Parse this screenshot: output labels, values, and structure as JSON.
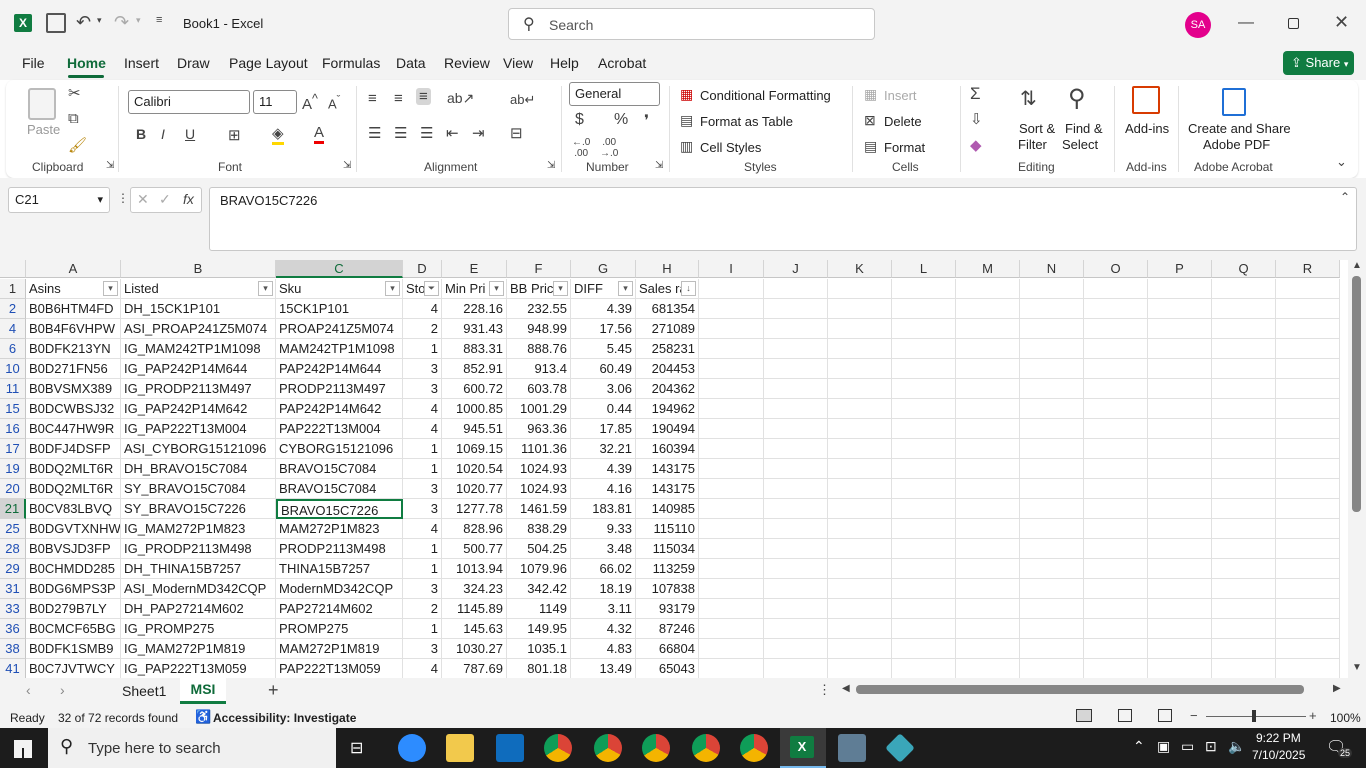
{
  "title_bar": {
    "doc_title": "Book1  -  Excel",
    "search_placeholder": "Search",
    "user_initials": "SA",
    "accent_color": "#0f6b3a"
  },
  "ribbon_tabs": [
    "File",
    "Home",
    "Insert",
    "Draw",
    "Page Layout",
    "Formulas",
    "Data",
    "Review",
    "View",
    "Help",
    "Acrobat"
  ],
  "share_label": "Share",
  "ribbon": {
    "paste": "Paste",
    "clipboard": "Clipboard",
    "font_name": "Calibri",
    "font_size": "11",
    "font_group": "Font",
    "alignment_group": "Alignment",
    "number_format": "General",
    "number_group": "Number",
    "cond_format": "Conditional Formatting",
    "format_table": "Format as Table",
    "cell_styles": "Cell Styles",
    "styles_group": "Styles",
    "insert": "Insert",
    "delete": "Delete",
    "format": "Format",
    "cells_group": "Cells",
    "sort_filter_1": "Sort &",
    "sort_filter_2": "Filter",
    "find_select_1": "Find &",
    "find_select_2": "Select",
    "editing_group": "Editing",
    "addins": "Add-ins",
    "addins_group": "Add-ins",
    "create_pdf_1": "Create and Share",
    "create_pdf_2": "Adobe PDF",
    "acrobat_group": "Adobe Acrobat"
  },
  "formula_bar": {
    "name_box": "C21",
    "formula": "BRAVO15C7226"
  },
  "columns": [
    "A",
    "B",
    "C",
    "D",
    "E",
    "F",
    "G",
    "H",
    "I",
    "J",
    "K",
    "L",
    "M",
    "N",
    "O",
    "P",
    "Q",
    "R"
  ],
  "headers": [
    "Asins",
    "Listed",
    "Sku",
    "Sto",
    "Min Pri",
    "BB Pric",
    "DIFF",
    "Sales ra"
  ],
  "rows": [
    {
      "n": "1",
      "cells": [
        "Asins",
        "Listed",
        "Sku",
        "Sto",
        "Min Pri",
        "BB Pric",
        "DIFF",
        "Sales ra"
      ]
    },
    {
      "n": "2",
      "cells": [
        "B0B6HTM4FD",
        "DH_15CK1P101",
        "15CK1P101",
        "4",
        "228.16",
        "232.55",
        "4.39",
        "681354"
      ]
    },
    {
      "n": "4",
      "cells": [
        "B0B4F6VHPW",
        "ASI_PROAP241Z5M074",
        "PROAP241Z5M074",
        "2",
        "931.43",
        "948.99",
        "17.56",
        "271089"
      ]
    },
    {
      "n": "6",
      "cells": [
        "B0DFK213YN",
        "IG_MAM242TP1M1098",
        "MAM242TP1M1098",
        "1",
        "883.31",
        "888.76",
        "5.45",
        "258231"
      ]
    },
    {
      "n": "10",
      "cells": [
        "B0D271FN56",
        "IG_PAP242P14M644",
        "PAP242P14M644",
        "3",
        "852.91",
        "913.4",
        "60.49",
        "204453"
      ]
    },
    {
      "n": "11",
      "cells": [
        "B0BVSMX389",
        "IG_PRODP2113M497",
        "PRODP2113M497",
        "3",
        "600.72",
        "603.78",
        "3.06",
        "204362"
      ]
    },
    {
      "n": "15",
      "cells": [
        "B0DCWBSJ32",
        "IG_PAP242P14M642",
        "PAP242P14M642",
        "4",
        "1000.85",
        "1001.29",
        "0.44",
        "194962"
      ]
    },
    {
      "n": "16",
      "cells": [
        "B0C447HW9R",
        "IG_PAP222T13M004",
        "PAP222T13M004",
        "4",
        "945.51",
        "963.36",
        "17.85",
        "190494"
      ]
    },
    {
      "n": "17",
      "cells": [
        "B0DFJ4DSFP",
        "ASI_CYBORG15121096",
        "CYBORG15121096",
        "1",
        "1069.15",
        "1101.36",
        "32.21",
        "160394"
      ]
    },
    {
      "n": "19",
      "cells": [
        "B0DQ2MLT6R",
        "DH_BRAVO15C7084",
        "BRAVO15C7084",
        "1",
        "1020.54",
        "1024.93",
        "4.39",
        "143175"
      ]
    },
    {
      "n": "20",
      "cells": [
        "B0DQ2MLT6R",
        "SY_BRAVO15C7084",
        "BRAVO15C7084",
        "3",
        "1020.77",
        "1024.93",
        "4.16",
        "143175"
      ]
    },
    {
      "n": "21",
      "cells": [
        "B0CV83LBVQ",
        "SY_BRAVO15C7226",
        "BRAVO15C7226",
        "3",
        "1277.78",
        "1461.59",
        "183.81",
        "140985"
      ]
    },
    {
      "n": "25",
      "cells": [
        "B0DGVTXNHW",
        "IG_MAM272P1M823",
        "MAM272P1M823",
        "4",
        "828.96",
        "838.29",
        "9.33",
        "115110"
      ]
    },
    {
      "n": "28",
      "cells": [
        "B0BVSJD3FP",
        "IG_PRODP2113M498",
        "PRODP2113M498",
        "1",
        "500.77",
        "504.25",
        "3.48",
        "115034"
      ]
    },
    {
      "n": "29",
      "cells": [
        "B0CHMDD285",
        "DH_THINA15B7257",
        "THINA15B7257",
        "1",
        "1013.94",
        "1079.96",
        "66.02",
        "113259"
      ]
    },
    {
      "n": "31",
      "cells": [
        "B0DG6MPS3P",
        "ASI_ModernMD342CQP",
        "ModernMD342CQP",
        "3",
        "324.23",
        "342.42",
        "18.19",
        "107838"
      ]
    },
    {
      "n": "33",
      "cells": [
        "B0D279B7LY",
        "DH_PAP27214M602",
        "PAP27214M602",
        "2",
        "1145.89",
        "1149",
        "3.11",
        "93179"
      ]
    },
    {
      "n": "36",
      "cells": [
        "B0CMCF65BG",
        "IG_PROMP275",
        "PROMP275",
        "1",
        "145.63",
        "149.95",
        "4.32",
        "87246"
      ]
    },
    {
      "n": "38",
      "cells": [
        "B0DFK1SMB9",
        "IG_MAM272P1M819",
        "MAM272P1M819",
        "3",
        "1030.27",
        "1035.1",
        "4.83",
        "66804"
      ]
    },
    {
      "n": "41",
      "cells": [
        "B0C7JVTWCY",
        "IG_PAP222T13M059",
        "PAP222T13M059",
        "4",
        "787.69",
        "801.18",
        "13.49",
        "65043"
      ]
    }
  ],
  "sheets": [
    "Sheet1",
    "MSI"
  ],
  "active_sheet": "MSI",
  "status": {
    "ready": "Ready",
    "records": "32 of 72 records found",
    "accessibility": "Accessibility: Investigate",
    "zoom": "100%"
  },
  "taskbar": {
    "search_placeholder": "Type here to search",
    "time": "9:22 PM",
    "date": "7/10/2025",
    "notif_count": "25"
  }
}
